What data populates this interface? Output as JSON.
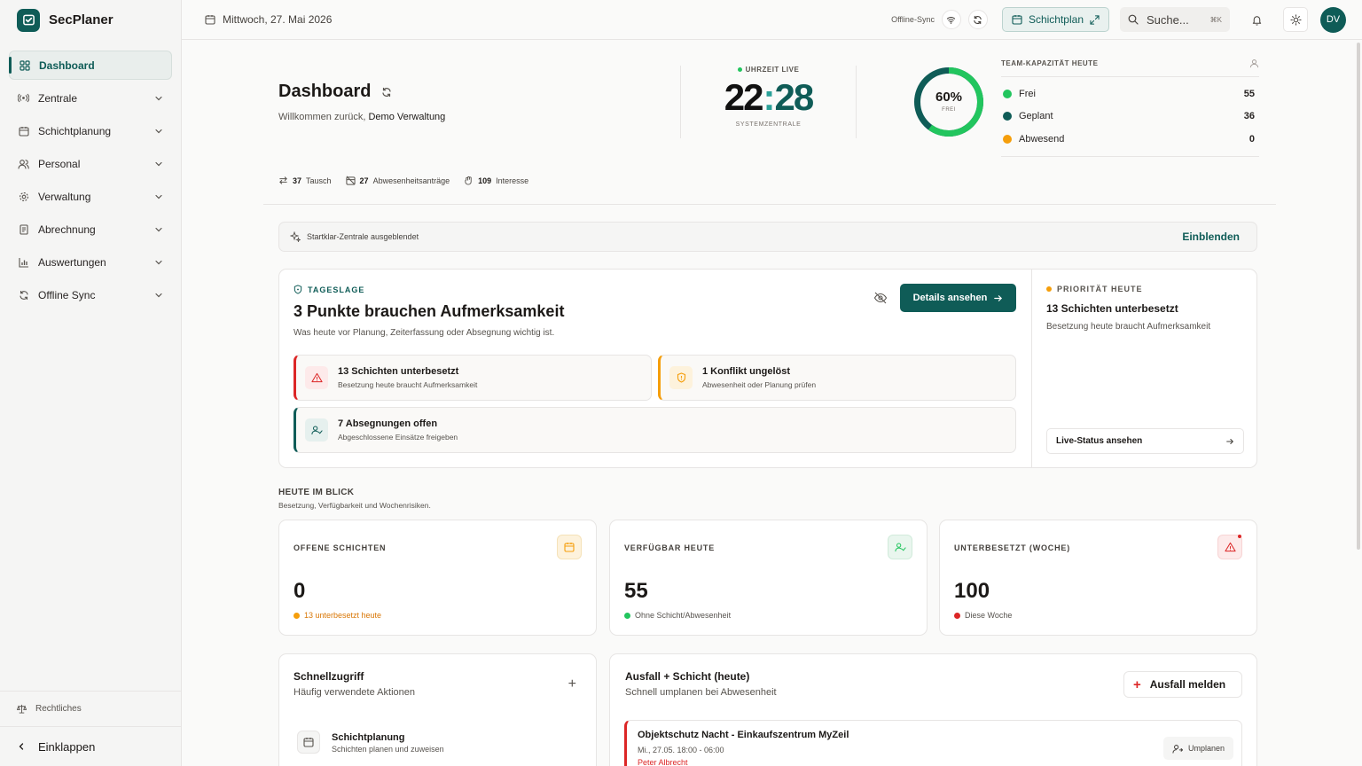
{
  "app": {
    "name": "SecPlaner"
  },
  "sidebar": {
    "items": [
      {
        "label": "Dashboard",
        "icon": "dashboard-icon"
      },
      {
        "label": "Zentrale",
        "icon": "radio-icon"
      },
      {
        "label": "Schichtplanung",
        "icon": "calendar-icon"
      },
      {
        "label": "Personal",
        "icon": "users-icon"
      },
      {
        "label": "Verwaltung",
        "icon": "gear-icon"
      },
      {
        "label": "Abrechnung",
        "icon": "receipt-icon"
      },
      {
        "label": "Auswertungen",
        "icon": "bar-chart-icon"
      },
      {
        "label": "Offline Sync",
        "icon": "sync-icon"
      }
    ],
    "legal": "Rechtliches",
    "collapse": "Einklappen"
  },
  "topbar": {
    "date": "Mittwoch, 27. Mai 2026",
    "sync_label": "Offline-Sync",
    "schichtplan": "Schichtplan",
    "search_placeholder": "Suche...",
    "search_shortcut": "⌘K",
    "avatar": "DV"
  },
  "hero": {
    "title": "Dashboard",
    "welcome": "Willkommen zurück,",
    "user": "Demo Verwaltung",
    "clock_label": "UHRZEIT LIVE",
    "clock_hours": "22",
    "clock_minutes": "28",
    "clock_sub": "SYSTEMZENTRALE",
    "donut_pct": "60%",
    "donut_label": "FREI",
    "donut_fraction": 0.6
  },
  "capacity": {
    "title": "TEAM-KAPAZITÄT HEUTE",
    "rows": [
      {
        "label": "Frei",
        "value": "55",
        "color": "#22c55e"
      },
      {
        "label": "Geplant",
        "value": "36",
        "color": "#0f5c57"
      },
      {
        "label": "Abwesend",
        "value": "0",
        "color": "#f59e0b"
      }
    ]
  },
  "stats": [
    {
      "value": "37",
      "label": "Tausch"
    },
    {
      "value": "27",
      "label": "Abwesenheitsanträge"
    },
    {
      "value": "109",
      "label": "Interesse"
    }
  ],
  "banner": {
    "text": "Startklar-Zentrale ausgeblendet",
    "action": "Einblenden"
  },
  "tageslage": {
    "eyebrow": "TAGESLAGE",
    "title": "3 Punkte brauchen Aufmerksamkeit",
    "subtitle": "Was heute vor Planung, Zeiterfassung oder Absegnung wichtig ist.",
    "details_button": "Details ansehen",
    "alerts": [
      {
        "title": "13 Schichten unterbesetzt",
        "sub": "Besetzung heute braucht Aufmerksamkeit"
      },
      {
        "title": "1 Konflikt ungelöst",
        "sub": "Abwesenheit oder Planung prüfen"
      },
      {
        "title": "7 Absegnungen offen",
        "sub": "Abgeschlossene Einsätze freigeben"
      }
    ],
    "priority": {
      "eyebrow": "PRIORITÄT HEUTE",
      "title": "13 Schichten unterbesetzt",
      "sub": "Besetzung heute braucht Aufmerksamkeit",
      "button": "Live-Status ansehen"
    }
  },
  "overview": {
    "title": "HEUTE IM BLICK",
    "subtitle": "Besetzung, Verfügbarkeit und Wochenrisiken.",
    "kpis": [
      {
        "label": "OFFENE SCHICHTEN",
        "value": "0",
        "sub": "13 unterbesetzt heute",
        "color": "#f59e0b"
      },
      {
        "label": "VERFÜGBAR HEUTE",
        "value": "55",
        "sub": "Ohne Schicht/Abwesenheit",
        "color": "#22c55e"
      },
      {
        "label": "UNTERBESETZT (WOCHE)",
        "value": "100",
        "sub": "Diese Woche",
        "color": "#dc2626"
      }
    ]
  },
  "quick": {
    "title": "Schnellzugriff",
    "subtitle": "Häufig verwendete Aktionen",
    "items": [
      {
        "title": "Schichtplanung",
        "sub": "Schichten planen und zuweisen"
      }
    ]
  },
  "ausfall": {
    "title": "Ausfall + Schicht (heute)",
    "subtitle": "Schnell umplanen bei Abwesenheit",
    "button": "Ausfall melden",
    "shift": {
      "title": "Objektschutz Nacht - Einkaufszentrum MyZeil",
      "time": "Mi., 27.05. 18:00 - 06:00",
      "person": "Peter Albrecht",
      "action": "Umplanen"
    }
  }
}
